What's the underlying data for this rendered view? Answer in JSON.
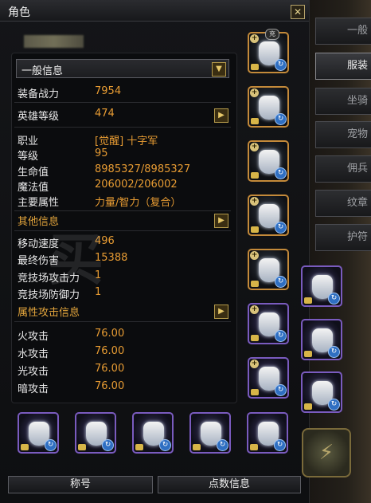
{
  "window": {
    "title": "角色"
  },
  "side_tabs": [
    {
      "label": "一般",
      "active": false
    },
    {
      "label": "服装",
      "active": true
    },
    {
      "label": "坐骑",
      "active": false
    },
    {
      "label": "宠物",
      "active": false
    },
    {
      "label": "佣兵",
      "active": false
    },
    {
      "label": "纹章",
      "active": false
    },
    {
      "label": "护符",
      "active": false
    }
  ],
  "info": {
    "dropdown_label": "一般信息",
    "rows": [
      {
        "label": "装备战力",
        "value": "7954"
      },
      {
        "label": "英雄等级",
        "value": "474"
      },
      {
        "label": "职业",
        "value": "[觉醒] 十字军"
      },
      {
        "label": "等级",
        "value": "95"
      },
      {
        "label": "生命值",
        "value": "8985327/8985327"
      },
      {
        "label": "魔法值",
        "value": "206002/206002"
      },
      {
        "label": "主要属性",
        "value": "力量/智力（复合）"
      },
      {
        "label": "其他信息",
        "value": ""
      },
      {
        "label": "移动速度",
        "value": "496"
      },
      {
        "label": "最终伤害",
        "value": "15388"
      },
      {
        "label": "竞技场攻击力",
        "value": "1"
      },
      {
        "label": "竞技场防御力",
        "value": "1"
      },
      {
        "label": "属性攻击信息",
        "value": ""
      },
      {
        "label": "火攻击",
        "value": "76.00"
      },
      {
        "label": "水攻击",
        "value": "76.00"
      },
      {
        "label": "光攻击",
        "value": "76.00"
      },
      {
        "label": "暗攻击",
        "value": "76.00"
      }
    ]
  },
  "slot_badge": "充",
  "bottom_buttons": {
    "title": "称号",
    "points": "点数信息"
  },
  "watermark": "买",
  "colors": {
    "accent": "#e89c33",
    "section": "#e3a53c",
    "frame_gold": "#8e6a3a",
    "frame_purple": "#7a5bbf"
  }
}
